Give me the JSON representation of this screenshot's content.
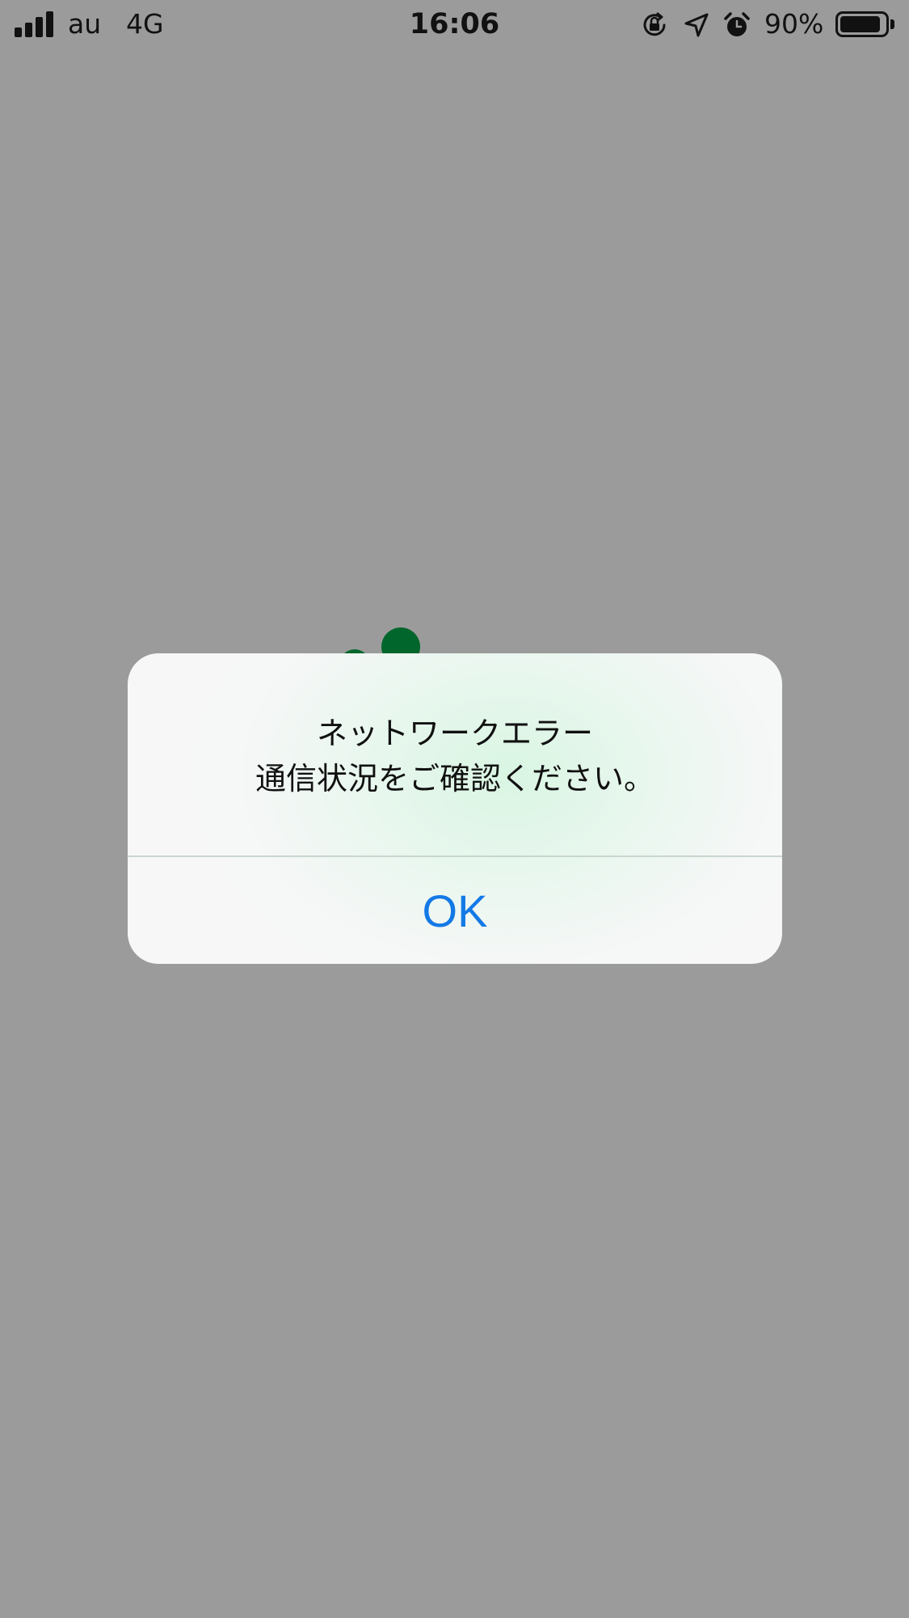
{
  "status_bar": {
    "carrier": "au",
    "network": "4G",
    "time": "16:06",
    "battery_percent": "90%",
    "battery_level": 0.9,
    "icons": [
      "signal-icon",
      "orientation-lock-icon",
      "location-icon",
      "alarm-icon",
      "battery-icon"
    ]
  },
  "alert": {
    "title": "ネットワークエラー",
    "message": "通信状況をご確認ください。",
    "ok_label": "OK"
  },
  "colors": {
    "backdrop": "#9b9b9b",
    "accent": "#1479e6",
    "brand_green": "#00662c",
    "alert_background": "#f7f7f7"
  }
}
